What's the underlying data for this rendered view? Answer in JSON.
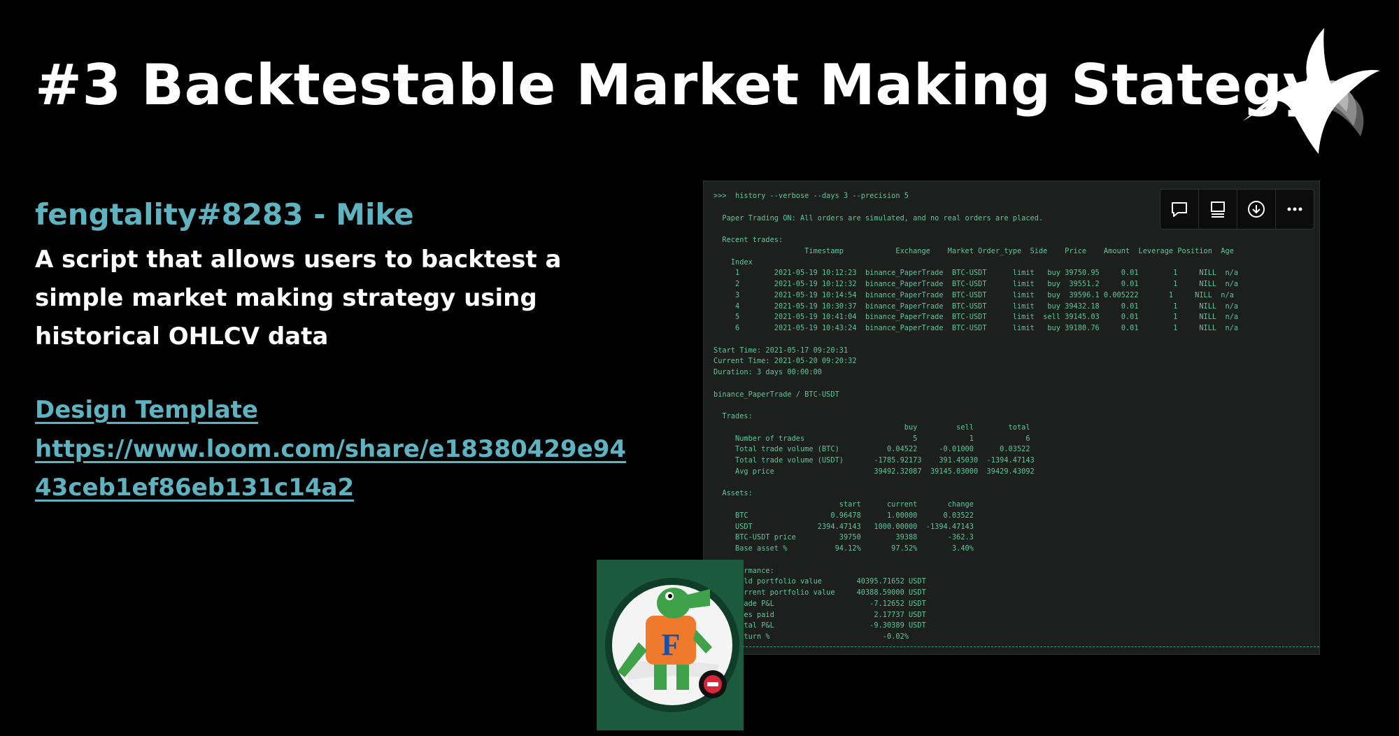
{
  "slide": {
    "title": "#3 Backtestable Market Making Stategy",
    "author": "fengtality#8283 - Mike",
    "description": "A script that allows users to backtest a simple market making strategy using historical OHLCV data",
    "link_label": "Design Template",
    "url_line1": "https://www.loom.com/share/e18380429e94",
    "url_line2": "43ceb1ef86eb131c14a2"
  },
  "terminal": {
    "content": ">>>  history --verbose --days 3 --precision 5\n\n  Paper Trading ON: All orders are simulated, and no real orders are placed.\n\n  Recent trades:\n                     Timestamp            Exchange    Market Order_type  Side    Price    Amount  Leverage Position  Age\n    Index\n     1        2021-05-19 10:12:23  binance_PaperTrade  BTC-USDT      limit   buy 39750.95     0.01        1     NILL  n/a\n     2        2021-05-19 10:12:32  binance_PaperTrade  BTC-USDT      limit   buy  39551.2     0.01        1     NILL  n/a\n     3        2021-05-19 10:14:54  binance_PaperTrade  BTC-USDT      limit   buy  39596.1 0.005222       1     NILL  n/a\n     4        2021-05-19 10:30:37  binance_PaperTrade  BTC-USDT      limit   buy 39432.18     0.01        1     NILL  n/a\n     5        2021-05-19 10:41:04  binance_PaperTrade  BTC-USDT      limit  sell 39145.03     0.01        1     NILL  n/a\n     6        2021-05-19 10:43:24  binance_PaperTrade  BTC-USDT      limit   buy 39180.76     0.01        1     NILL  n/a\n\nStart Time: 2021-05-17 09:20:31\nCurrent Time: 2021-05-20 09:20:32\nDuration: 3 days 00:00:00\n\nbinance_PaperTrade / BTC-USDT\n\n  Trades:\n                                            buy         sell        total\n     Number of trades                         5            1            6\n     Total trade volume (BTC)           0.04522     -0.01000      0.03522\n     Total trade volume (USDT)       -1785.92173    391.45030  -1394.47143\n     Avg price                       39492.32087  39145.03000  39429.43092\n\n  Assets:\n                             start      current       change\n     BTC                   0.96478      1.00000      0.03522\n     USDT               2394.47143   1000.00000  -1394.47143\n     BTC-USDT price          39750        39388       -362.3\n     Base asset %           94.12%       97.52%        3.40%\n\n  Performance:\n     Hold portfolio value        40395.71652 USDT\n     Current portfolio value     40388.59000 USDT\n     Trade P&L                      -7.12652 USDT\n     Fees paid                       2.17737 USDT\n     Total P&L                      -9.30389 USDT\n     Return %                          -0.02%"
  },
  "toolbar": {
    "icons": [
      "comment-icon",
      "layout-icon",
      "download-icon",
      "more-icon"
    ]
  },
  "colors": {
    "background": "#000000",
    "accent": "#5fb3c1",
    "terminal_text": "#5ec59a",
    "terminal_bg": "#1c1f1e",
    "webcam_bg": "#1c5a3d"
  }
}
